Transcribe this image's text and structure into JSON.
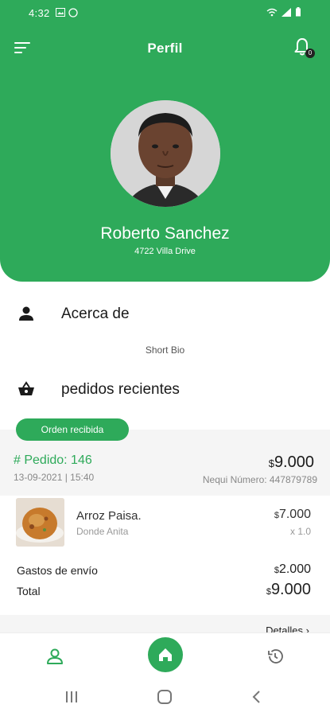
{
  "status_bar": {
    "time": "4:32",
    "icons": [
      "image-icon",
      "clock-icon",
      "wifi-icon",
      "signal-icon",
      "battery-icon"
    ]
  },
  "header": {
    "title": "Perfil",
    "notification_count": "0",
    "background_color": "#2eaa5a"
  },
  "profile": {
    "name": "Roberto Sanchez",
    "address": "4722 Villa Drive"
  },
  "about": {
    "label": "Acerca de",
    "short_bio": "Short Bio"
  },
  "recent_orders": {
    "label": "pedidos recientes",
    "status_badge": "Orden recibida"
  },
  "order": {
    "number": "# Pedido: 146",
    "date": "13-09-2021 | 15:40",
    "total_currency": "$",
    "total": "9.000",
    "nequi": "Nequi Número: 447879789",
    "item": {
      "name": "Arroz Paisa.",
      "store": "Donde Anita",
      "price_currency": "$",
      "price": "7.000",
      "quantity": "x 1.0"
    },
    "shipping_label": "Gastos de envío",
    "shipping_currency": "$",
    "shipping_value": "2.000",
    "total_label": "Total",
    "grand_total_currency": "$",
    "grand_total": "9.000",
    "details_label": "Detalles"
  },
  "bottom_nav": {
    "items": [
      "profile-icon",
      "home-icon",
      "history-icon"
    ]
  },
  "system_nav": {
    "items": [
      "recents-icon",
      "home-circle-icon",
      "back-icon"
    ]
  },
  "colors": {
    "accent": "#2eaa5a",
    "card_bg": "#f5f5f5"
  }
}
